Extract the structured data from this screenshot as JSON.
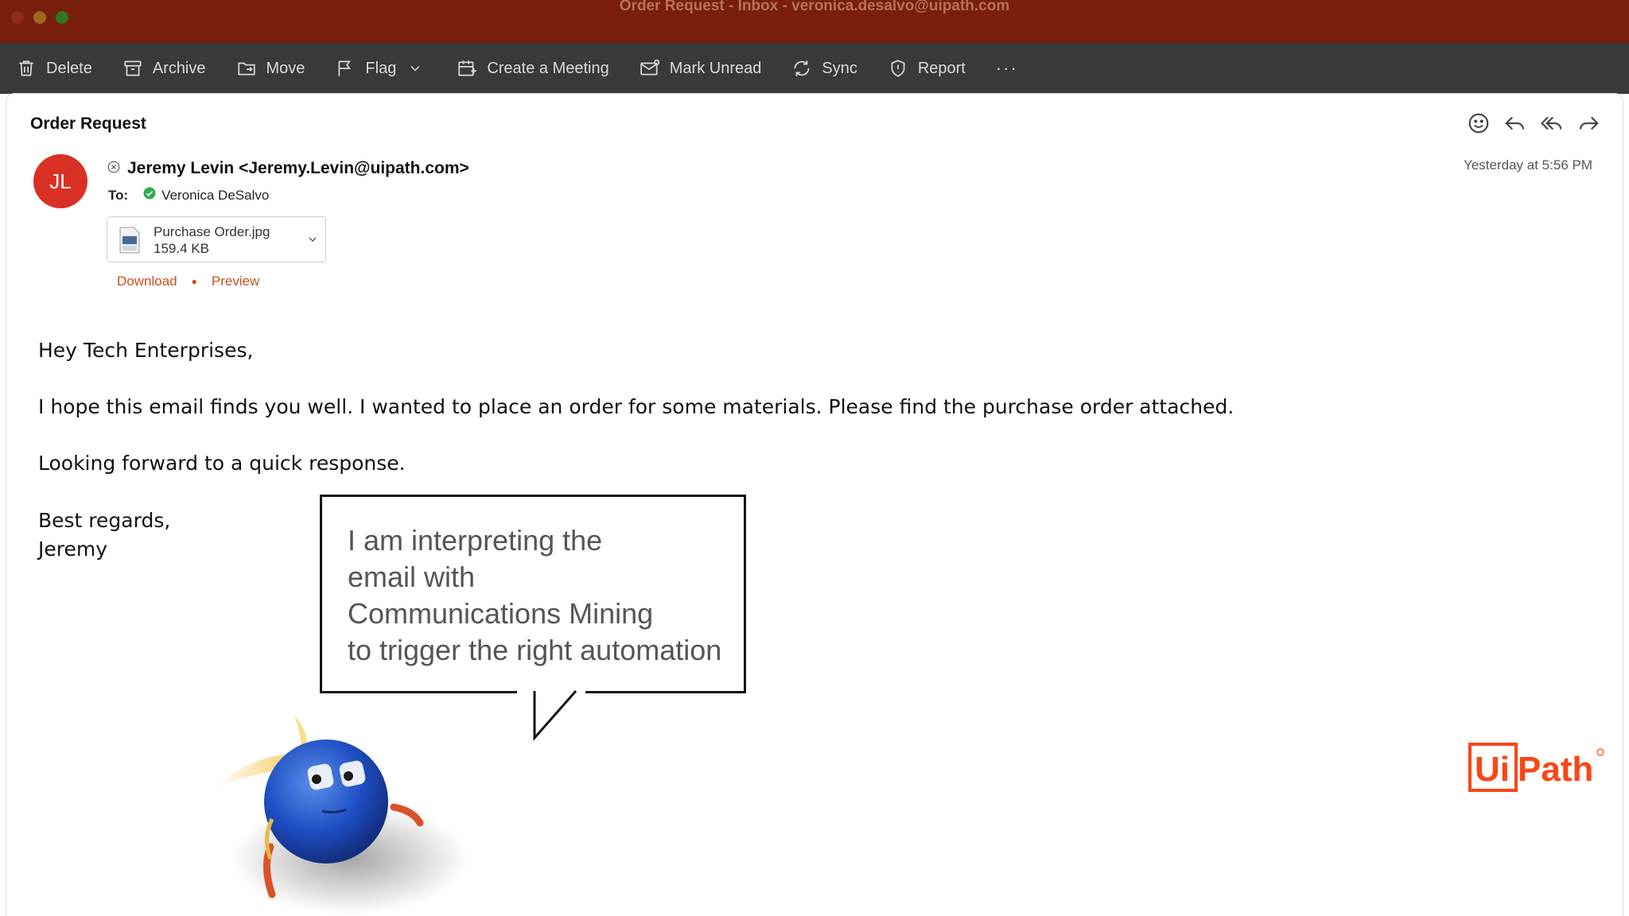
{
  "window": {
    "title": "Order Request - Inbox - veronica.desalvo@uipath.com"
  },
  "toolbar": {
    "delete": "Delete",
    "archive": "Archive",
    "move": "Move",
    "flag": "Flag",
    "create_meeting": "Create a Meeting",
    "mark_unread": "Mark Unread",
    "sync": "Sync",
    "report": "Report",
    "more": "···"
  },
  "message": {
    "subject": "Order Request",
    "avatar_initials": "JL",
    "avatar_color": "#d93025",
    "sender": "Jeremy Levin <Jeremy.Levin@uipath.com>",
    "timestamp": "Yesterday at 5:56 PM",
    "to_label": "To:",
    "recipient": "Veronica DeSalvo",
    "attachment": {
      "name": "Purchase Order.jpg",
      "size": "159.4 KB",
      "download_label": "Download",
      "preview_label": "Preview"
    },
    "body": {
      "greeting": "Hey Tech Enterprises,",
      "paragraph1": "I hope this email finds you well. I wanted to place an order for some materials. Please find the purchase order attached.",
      "paragraph2": "Looking forward to a quick response.",
      "signoff": "Best regards,",
      "signature": "Jeremy"
    }
  },
  "overlay": {
    "speech_bubble": "I am interpreting the\nemail with\nCommunications Mining\nto trigger the right automation",
    "logo_text": "UiPath",
    "logo_color": "#fa4616"
  },
  "colors": {
    "titlebar": "#7a1f0e",
    "toolbar": "#3a3a3a",
    "link": "#c8501e"
  }
}
